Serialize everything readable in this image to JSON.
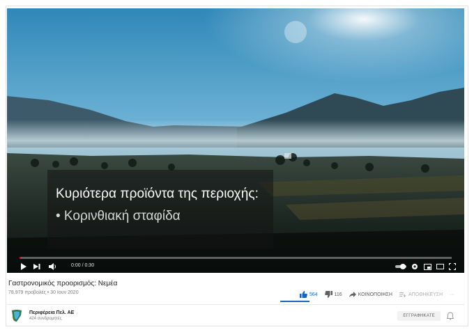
{
  "player": {
    "caption_title": "Κυριότερα προϊόντα της περιοχής:",
    "caption_subtitle": "• Κορινθιακή σταφίδα",
    "time_display": "0:00 / 0:30",
    "progress": 0.003,
    "controls": [
      "play-icon",
      "next-icon",
      "volume-icon",
      "autoplay-toggle",
      "settings-icon",
      "miniplayer-icon",
      "theater-icon",
      "fullscreen-icon"
    ],
    "accent_color": "#ff0000"
  },
  "video": {
    "title": "Γαστρονομικός προορισμός: Νεμέα",
    "views": "78.979 προβολές • 30 Ιουν 2020"
  },
  "actions": {
    "likes": "564",
    "dislikes": "116",
    "share_label": "ΚΟΙΝΟΠΟΙΗΣΗ",
    "save_label": "ΑΠΟΘΗΚΕΥΣΗ",
    "like_color": "#1565c0"
  },
  "channel": {
    "name": "Περιφέρεια Πελ. ΑΕ",
    "subscribers": "424 συνδρομητές",
    "subscribe_label": "ΕΓΓΡΑΦΗΚΑΤΕ"
  }
}
